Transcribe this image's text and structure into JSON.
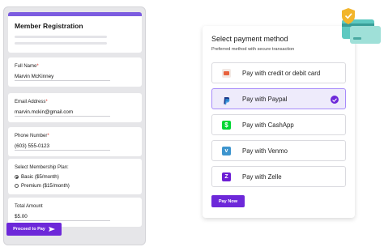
{
  "registration": {
    "title": "Member Registration",
    "full_name": {
      "label": "Full Name",
      "value": "Marvin McKinney"
    },
    "email": {
      "label": "Email Address",
      "value": "marvin.mckin@gmail.com"
    },
    "phone": {
      "label": "Phone Number",
      "value": "(603) 555-0123"
    },
    "plan": {
      "label": "Select Membership Plan:",
      "options": [
        "Basic ($5/month)",
        "Premium ($15/month)"
      ],
      "selected": "Basic ($5/month)"
    },
    "total": {
      "label": "Total Amount",
      "value": "$5.00"
    },
    "required_mark": "*",
    "proceed_label": "Proceed to Pay"
  },
  "payment": {
    "title": "Select payment method",
    "subtitle": "Preferred method with secure transaction",
    "options": [
      {
        "label": "Pay with credit or debit card",
        "icon": "credit-card-icon"
      },
      {
        "label": "Pay with Paypal",
        "icon": "paypal-icon",
        "selected": true
      },
      {
        "label": "Pay with CashApp",
        "icon": "cashapp-icon"
      },
      {
        "label": "Pay with Venmo",
        "icon": "venmo-icon"
      },
      {
        "label": "Pay with Zelle",
        "icon": "zelle-icon"
      }
    ],
    "pay_now_label": "Pay Now"
  },
  "colors": {
    "accent": "#6d28d9",
    "selected_bg": "#eeebfb",
    "panel_bg": "#e6e6e9"
  }
}
